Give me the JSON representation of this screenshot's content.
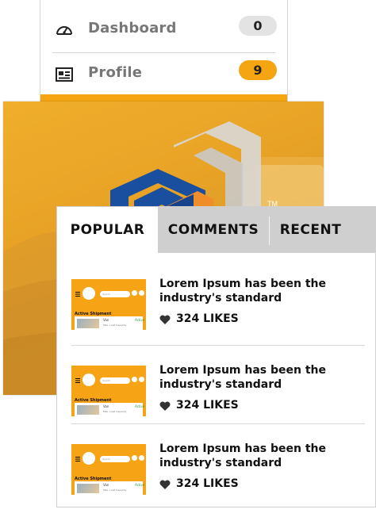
{
  "menu": {
    "items": [
      {
        "label": "Dashboard",
        "icon": "speedometer-icon",
        "badge": "0",
        "badge_color": "#e3e3e3"
      },
      {
        "label": "Profile",
        "icon": "id-card-icon",
        "badge": "9",
        "badge_color": "#f5a511"
      }
    ]
  },
  "hero": {
    "logo_icon": "cube-logo-icon",
    "trademark": "TM",
    "colors": {
      "accent": "#f5a511",
      "logo_blue": "#1a4fa0",
      "logo_grey": "#d8d8d8"
    }
  },
  "tabs": [
    {
      "label": "POPULAR",
      "active": true
    },
    {
      "label": "COMMENTS",
      "active": false
    },
    {
      "label": "RECENT",
      "active": false
    }
  ],
  "posts": [
    {
      "title": "Lorem Ipsum has been the industry's standard",
      "likes": "324 LIKES",
      "thumb": {
        "search": "Search",
        "section": "Active Shipment",
        "vehicle": "Van",
        "detail": "Max. Load Capacity",
        "status": "Active"
      }
    },
    {
      "title": "Lorem Ipsum has been the industry's standard",
      "likes": "324 LIKES",
      "thumb": {
        "search": "Search",
        "section": "Active Shipment",
        "vehicle": "Van",
        "detail": "Max. Load Capacity",
        "status": "Active"
      }
    },
    {
      "title": "Lorem Ipsum has been the industry's standard",
      "likes": "324 LIKES",
      "thumb": {
        "search": "Search",
        "section": "Active Shipment",
        "vehicle": "Van",
        "detail": "Max. Load Capacity",
        "status": "Active"
      }
    }
  ]
}
